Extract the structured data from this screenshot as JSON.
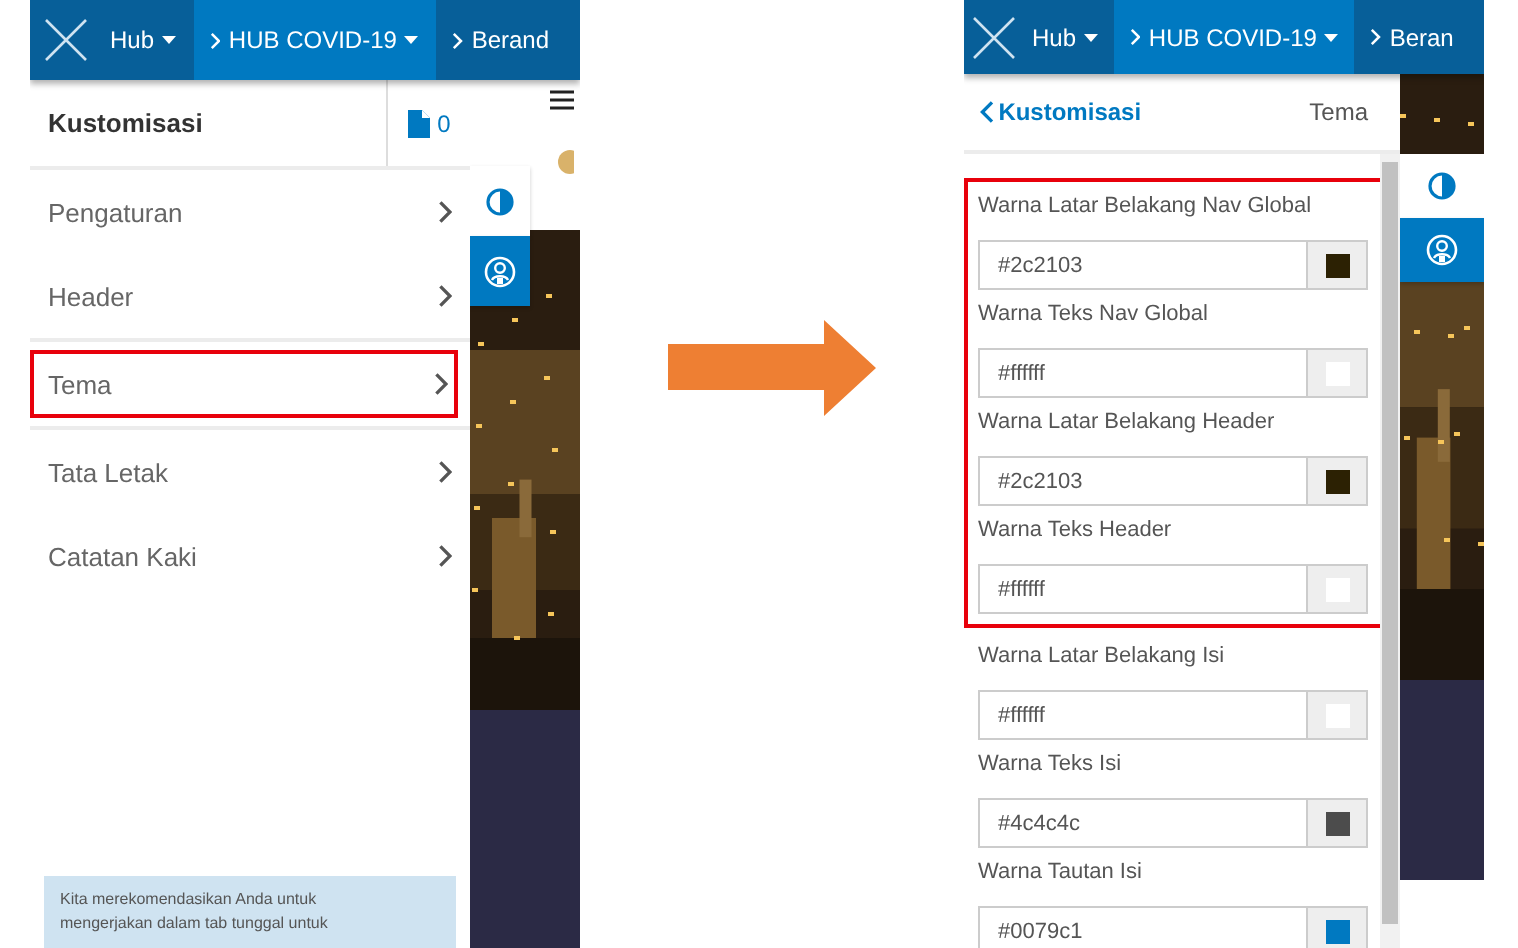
{
  "screens": [
    {
      "kind": "menu",
      "nav": [
        {
          "label": "Hub",
          "kind": "root",
          "selected": false
        },
        {
          "label": "HUB COVID-19",
          "kind": "crumb",
          "selected": true
        },
        {
          "label": "Berand",
          "kind": "crumb",
          "selected": false
        }
      ],
      "side_tabs": [
        {
          "kind": "theme",
          "selected": true
        },
        {
          "kind": "profile",
          "selected": false
        }
      ],
      "panel_title": "Kustomisasi",
      "page_count": "0",
      "menu_items": [
        {
          "label": "Pengaturan",
          "highlighted": false
        },
        {
          "label": "Header",
          "highlighted": false
        },
        {
          "label": "Tema",
          "highlighted": true
        },
        {
          "label": "Tata Letak",
          "highlighted": false
        },
        {
          "label": "Catatan Kaki",
          "highlighted": false
        }
      ],
      "notice": "Kita merekomendasikan Anda untuk mengerjakan dalam tab tunggal untuk"
    },
    {
      "kind": "form",
      "nav": [
        {
          "label": "Hub",
          "kind": "root",
          "selected": false
        },
        {
          "label": "HUB COVID-19",
          "kind": "crumb",
          "selected": true
        },
        {
          "label": "Beran",
          "kind": "crumb",
          "selected": false
        }
      ],
      "side_tabs": [
        {
          "kind": "theme",
          "selected": true
        },
        {
          "kind": "profile",
          "selected": false
        }
      ],
      "back_link": "Kustomisasi",
      "section_title": "Tema",
      "fields": [
        {
          "label": "Warna Latar Belakang Nav Global",
          "value": "#2c2103",
          "color": "#2c2103",
          "highlighted": true
        },
        {
          "label": "Warna Teks Nav Global",
          "value": "#ffffff",
          "color": "#ffffff",
          "highlighted": true
        },
        {
          "label": "Warna Latar Belakang Header",
          "value": "#2c2103",
          "color": "#2c2103",
          "highlighted": true
        },
        {
          "label": "Warna Teks Header",
          "value": "#ffffff",
          "color": "#ffffff",
          "highlighted": true
        },
        {
          "label": "Warna Latar Belakang Isi",
          "value": "#ffffff",
          "color": "#ffffff",
          "highlighted": false
        },
        {
          "label": "Warna Teks Isi",
          "value": "#4c4c4c",
          "color": "#4c4c4c",
          "highlighted": false
        },
        {
          "label": "Warna Tautan Isi",
          "value": "#0079c1",
          "color": "#0079c1",
          "highlighted": false
        }
      ]
    }
  ]
}
